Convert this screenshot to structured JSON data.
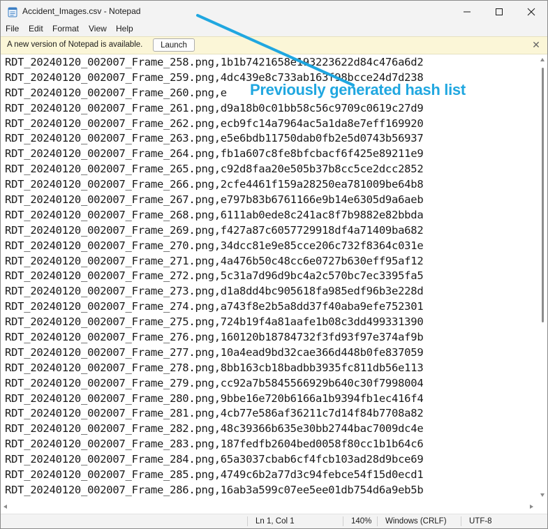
{
  "window": {
    "title": "Accident_Images.csv - Notepad",
    "icons": {
      "app": "notepad-icon",
      "minimize": "minimize-icon",
      "maximize": "maximize-icon",
      "close": "close-icon"
    }
  },
  "menu": {
    "items": [
      {
        "label": "File"
      },
      {
        "label": "Edit"
      },
      {
        "label": "Format"
      },
      {
        "label": "View"
      },
      {
        "label": "Help"
      }
    ]
  },
  "infobar": {
    "message": "A new version of Notepad is available.",
    "button_label": "Launch",
    "close_glyph": "✕"
  },
  "editor": {
    "lines": [
      "RDT_20240120_002007_Frame_258.png,1b1b7421658e193223622d84c476a6d2",
      "RDT_20240120_002007_Frame_259.png,4dc439e8c733ab163f98bcce24d7d238",
      "RDT_20240120_002007_Frame_260.png,e",
      "RDT_20240120_002007_Frame_261.png,d9a18b0c01bb58c56c9709c0619c27d9",
      "RDT_20240120_002007_Frame_262.png,ecb9fc14a7964ac5a1da8e7eff169920",
      "RDT_20240120_002007_Frame_263.png,e5e6bdb11750dab0fb2e5d0743b56937",
      "RDT_20240120_002007_Frame_264.png,fb1a607c8fe8bfcbacf6f425e89211e9",
      "RDT_20240120_002007_Frame_265.png,c92d8faa20e505b37b8cc5ce2dcc2852",
      "RDT_20240120_002007_Frame_266.png,2cfe4461f159a28250ea781009be64b8",
      "RDT_20240120_002007_Frame_267.png,e797b83b6761166e9b14e6305d9a6aeb",
      "RDT_20240120_002007_Frame_268.png,6111ab0ede8c241ac8f7b9882e82bbda",
      "RDT_20240120_002007_Frame_269.png,f427a87c6057729918df4a71409ba682",
      "RDT_20240120_002007_Frame_270.png,34dcc81e9e85cce206c732f8364c031e",
      "RDT_20240120_002007_Frame_271.png,4a476b50c48cc6e0727b630eff95af12",
      "RDT_20240120_002007_Frame_272.png,5c31a7d96d9bc4a2c570bc7ec3395fa5",
      "RDT_20240120_002007_Frame_273.png,d1a8dd4bc905618fa985edf96b3e228d",
      "RDT_20240120_002007_Frame_274.png,a743f8e2b5a8dd37f40aba9efe752301",
      "RDT_20240120_002007_Frame_275.png,724b19f4a81aafe1b08c3dd499331390",
      "RDT_20240120_002007_Frame_276.png,160120b18784732f3fd93f97e374af9b",
      "RDT_20240120_002007_Frame_277.png,10a4ead9bd32cae366d448b0fe837059",
      "RDT_20240120_002007_Frame_278.png,8bb163cb18badbb3935fc811db56e113",
      "RDT_20240120_002007_Frame_279.png,cc92a7b5845566929b640c30f7998004",
      "RDT_20240120_002007_Frame_280.png,9bbe16e720b6166a1b9394fb1ec416f4",
      "RDT_20240120_002007_Frame_281.png,4cb77e586af36211c7d14f84b7708a82",
      "RDT_20240120_002007_Frame_282.png,48c39366b635e30bb2744bac7009dc4e",
      "RDT_20240120_002007_Frame_283.png,187fedfb2604bed0058f80cc1b1b64c6",
      "RDT_20240120_002007_Frame_284.png,65a3037cbab6cf4fcb103ad28d9bce69",
      "RDT_20240120_002007_Frame_285.png,4749c6b2a77d3c94febce54f15d0ecd1",
      "RDT_20240120_002007_Frame_286.png,16ab3a599c07ee5ee01db754d6a9eb5b"
    ]
  },
  "annotation": {
    "text": "Previously generated hash list",
    "color": "#20a7e0"
  },
  "status": {
    "position": "Ln 1, Col 1",
    "zoom": "140%",
    "line_ending": "Windows (CRLF)",
    "encoding": "UTF-8"
  }
}
